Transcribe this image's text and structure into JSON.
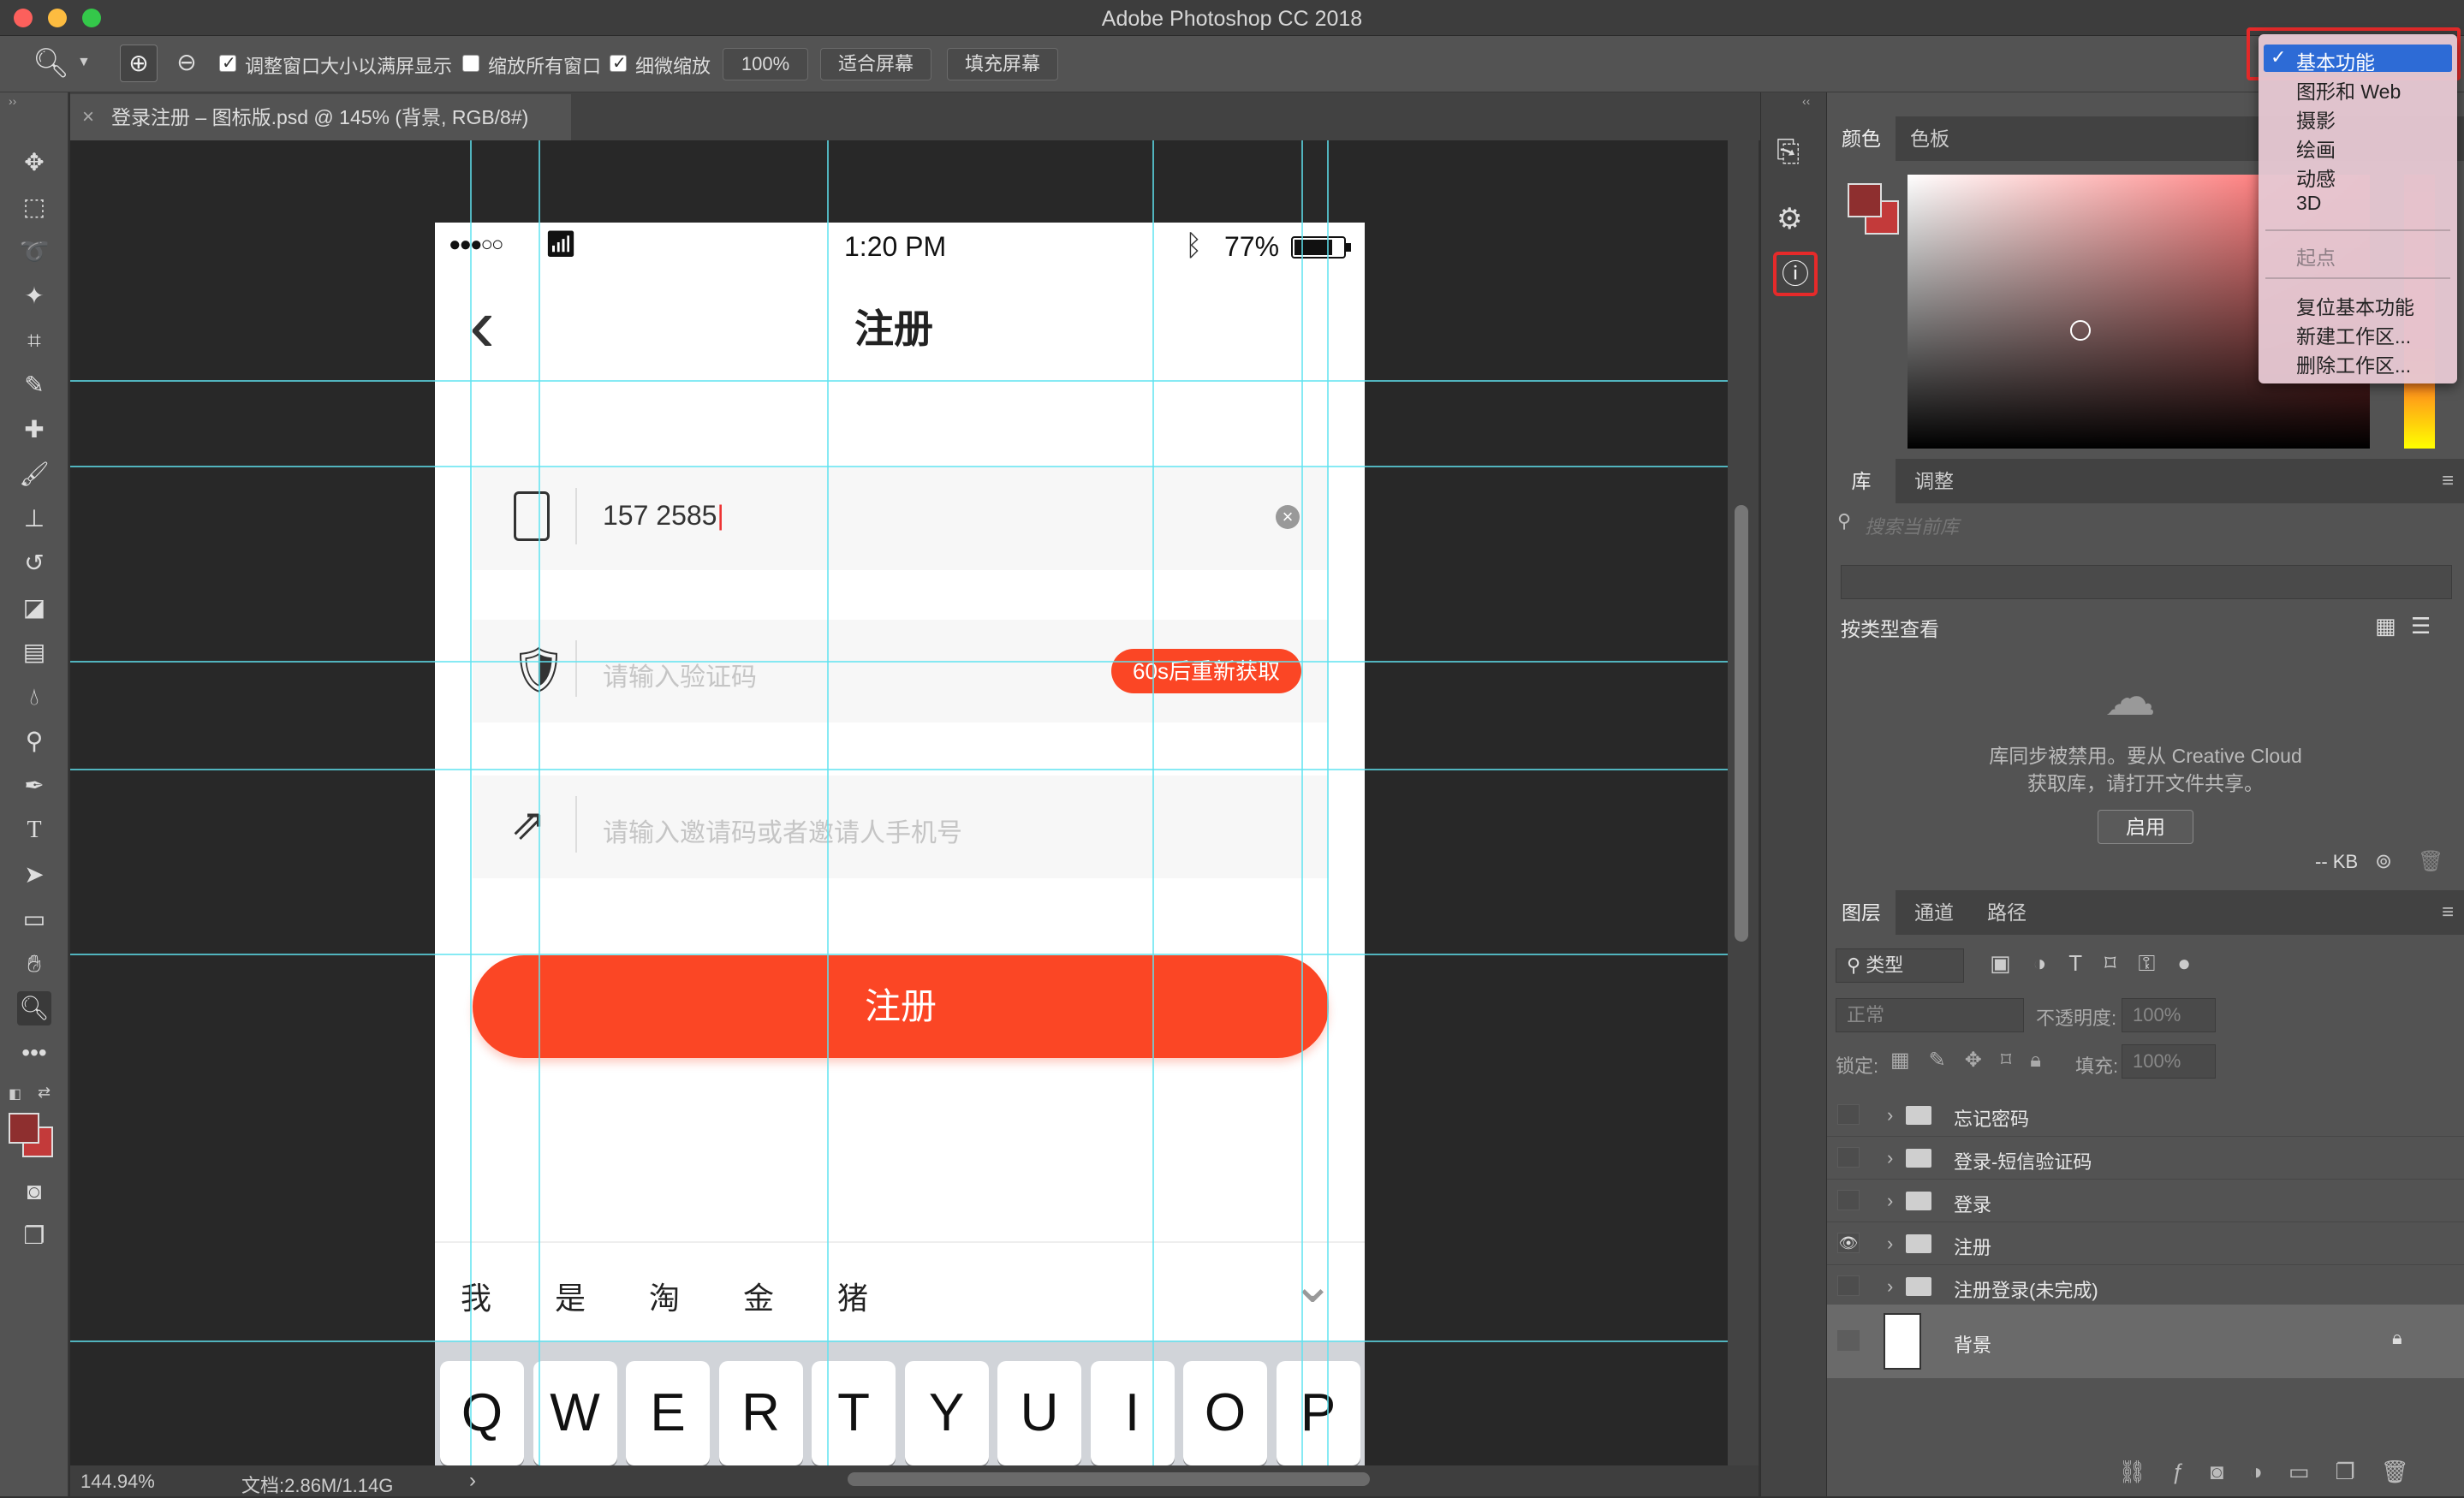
{
  "app": {
    "title": "Adobe Photoshop CC 2018"
  },
  "options": {
    "resize_windows": "调整窗口大小以满屏显示",
    "zoom_all": "缩放所有窗口",
    "scrubby_zoom": "细微缩放",
    "zoom_value": "100%",
    "fit_screen": "适合屏幕",
    "fill_screen": "填充屏幕"
  },
  "document": {
    "tab": "登录注册 – 图标版.psd @ 145% (背景, RGB/8#)",
    "close": "×"
  },
  "status": {
    "zoom": "144.94%",
    "doc": "文档:2.86M/1.14G",
    "arrow": "›"
  },
  "phone": {
    "signal": "●●●○○",
    "time": "1:20 PM",
    "battery": "77%",
    "back": "‹",
    "title": "注册",
    "phone_value": "157 2585",
    "code_placeholder": "请输入验证码",
    "resend": "60s后重新获取",
    "invite_placeholder": "请输入邀请码或者邀请人手机号",
    "register": "注册",
    "candidates": [
      "我",
      "是",
      "淘",
      "金",
      "猪"
    ],
    "keys": [
      "Q",
      "W",
      "E",
      "R",
      "T",
      "Y",
      "U",
      "I",
      "O",
      "P"
    ]
  },
  "workspace_menu": {
    "items": [
      "基本功能",
      "图形和 Web",
      "摄影",
      "绘画",
      "动感",
      "3D"
    ],
    "start": "起点",
    "actions": [
      "复位基本功能",
      "新建工作区...",
      "删除工作区..."
    ]
  },
  "color_panel": {
    "tabs": [
      "颜色",
      "色板"
    ],
    "fg_color": "#8e2f2f",
    "bg_color": "#c33a3a"
  },
  "library_panel": {
    "tabs": [
      "库",
      "调整"
    ],
    "search_placeholder": "搜索当前库",
    "view_by": "按类型查看",
    "disabled_msg1": "库同步被禁用。要从 Creative Cloud",
    "disabled_msg2": "获取库，请打开文件共享。",
    "enable": "启用",
    "kb": "-- KB"
  },
  "layers_panel": {
    "tabs": [
      "图层",
      "通道",
      "路径"
    ],
    "filter": "类型",
    "blend": "正常",
    "opacity_label": "不透明度:",
    "opacity": "100%",
    "lock_label": "锁定:",
    "fill_label": "填充:",
    "fill": "100%",
    "layers": [
      {
        "name": "忘记密码",
        "visible": false
      },
      {
        "name": "登录-短信验证码",
        "visible": false
      },
      {
        "name": "登录",
        "visible": false
      },
      {
        "name": "注册",
        "visible": true
      },
      {
        "name": "注册登录(未完成)",
        "visible": false
      }
    ],
    "background": "背景"
  },
  "colors": {
    "accent": "#fb4625",
    "guide": "#5fe3f0",
    "menu_highlight": "#2d6bd6"
  }
}
